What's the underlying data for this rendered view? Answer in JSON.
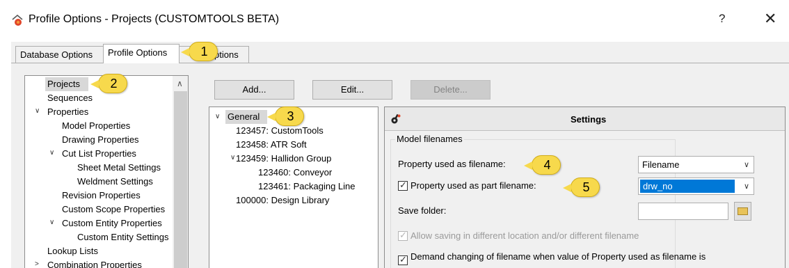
{
  "window": {
    "title": "Profile Options - Projects (CUSTOMTOOLS BETA)",
    "help_label": "?",
    "close_label": "✕"
  },
  "tabs": [
    {
      "label": "Database Options",
      "active": false
    },
    {
      "label": "Profile Options",
      "active": true
    },
    {
      "label": "ptions",
      "active": false
    }
  ],
  "left_tree": {
    "items": [
      {
        "label": "Projects",
        "selected": true
      },
      {
        "label": "Sequences"
      },
      {
        "label": "Properties",
        "expanded": true
      },
      {
        "label": "Model Properties"
      },
      {
        "label": "Drawing Properties"
      },
      {
        "label": "Cut List Properties",
        "expanded": true
      },
      {
        "label": "Sheet Metal Settings"
      },
      {
        "label": "Weldment Settings"
      },
      {
        "label": "Revision Properties"
      },
      {
        "label": "Custom Scope Properties"
      },
      {
        "label": "Custom Entity Properties",
        "expanded": true
      },
      {
        "label": "Custom Entity Settings"
      },
      {
        "label": "Lookup Lists"
      },
      {
        "label": "Combination Properties"
      }
    ]
  },
  "buttons": {
    "add": "Add...",
    "edit": "Edit...",
    "delete": "Delete..."
  },
  "mid_tree": {
    "items": [
      {
        "label": "General",
        "selected": true,
        "expanded": true
      },
      {
        "label": "123457: CustomTools"
      },
      {
        "label": "123458: ATR Soft"
      },
      {
        "label": "123459: Hallidon Group",
        "expanded": true
      },
      {
        "label": "123460: Conveyor"
      },
      {
        "label": "123461: Packaging Line"
      },
      {
        "label": "100000: Design Library"
      }
    ]
  },
  "settings": {
    "title": "Settings",
    "group_label": "Model filenames",
    "property_filename_label": "Property used as filename:",
    "property_filename_value": "Filename",
    "part_filename_label": "Property used as part filename:",
    "part_filename_checked": true,
    "part_filename_value": "drw_no",
    "save_folder_label": "Save folder:",
    "save_folder_value": "",
    "allow_saving_label": "Allow saving in different location and/or different filename",
    "allow_saving_checked": true,
    "demand_changing_label": "Demand changing of filename when value of Property used as filename is",
    "demand_changing_checked": true
  },
  "callouts": [
    "1",
    "2",
    "3",
    "4",
    "5"
  ],
  "colors": {
    "callout": "#f7d94c",
    "selection_blue": "#0078d7",
    "dialog_bg": "#f0f0f0"
  }
}
